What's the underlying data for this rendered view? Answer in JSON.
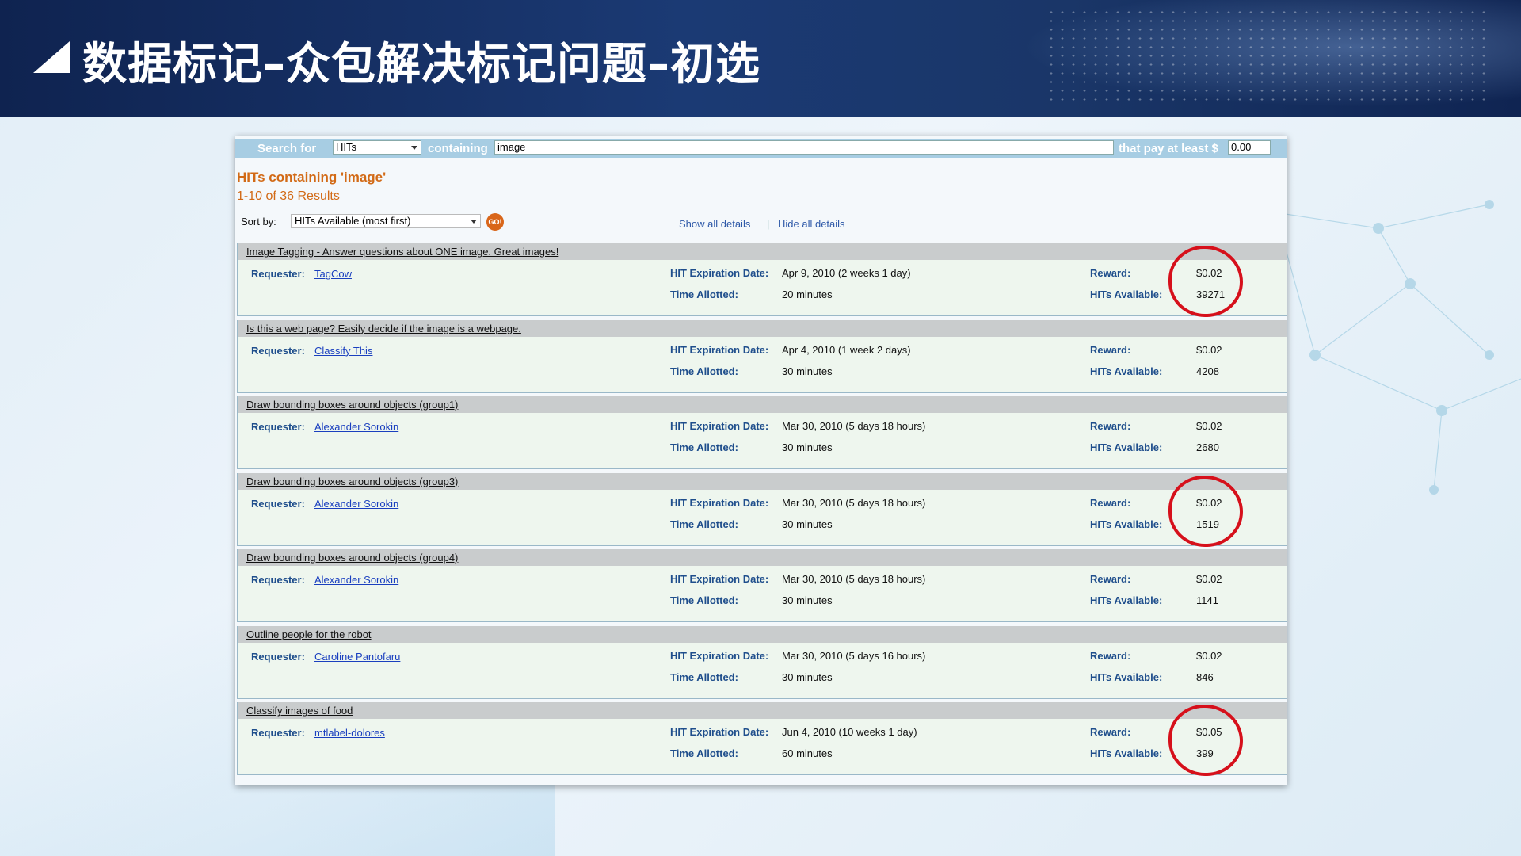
{
  "slide": {
    "title": "数据标记–众包解决标记问题–初选"
  },
  "search": {
    "search_for_label": "Search for",
    "type_value": "HITs",
    "containing_label": "containing",
    "query_value": "image",
    "pay_label": "that pay at least $",
    "pay_value": "0.00"
  },
  "results": {
    "title": "HITs containing 'image'",
    "count": "1-10 of 36 Results",
    "sort_label": "Sort by:",
    "sort_value": "HITs Available (most first)",
    "go_label": "GO!",
    "show_all": "Show all details",
    "separator": "|",
    "hide_all": "Hide all details"
  },
  "labels": {
    "requester": "Requester:",
    "expiration": "HIT Expiration Date:",
    "time_allotted": "Time Allotted:",
    "reward": "Reward:",
    "hits_available": "HITs Available:"
  },
  "hits": [
    {
      "title": "Image Tagging - Answer questions about ONE image. Great images!",
      "requester": "TagCow",
      "expiration": "Apr 9, 2010  (2 weeks 1 day)",
      "time": "20 minutes",
      "reward": "$0.02",
      "available": "39271",
      "circled": true
    },
    {
      "title": "Is this a web page? Easily decide if the image is a webpage.",
      "requester": "Classify This",
      "expiration": "Apr 4, 2010  (1 week 2 days)",
      "time": "30 minutes",
      "reward": "$0.02",
      "available": "4208",
      "circled": false
    },
    {
      "title": "Draw bounding boxes around objects (group1)",
      "requester": "Alexander Sorokin",
      "expiration": "Mar 30, 2010  (5 days 18 hours)",
      "time": "30 minutes",
      "reward": "$0.02",
      "available": "2680",
      "circled": false
    },
    {
      "title": "Draw bounding boxes around objects (group3)",
      "requester": "Alexander Sorokin",
      "expiration": "Mar 30, 2010  (5 days 18 hours)",
      "time": "30 minutes",
      "reward": "$0.02",
      "available": "1519",
      "circled": true
    },
    {
      "title": "Draw bounding boxes around objects (group4)",
      "requester": "Alexander Sorokin",
      "expiration": "Mar 30, 2010  (5 days 18 hours)",
      "time": "30 minutes",
      "reward": "$0.02",
      "available": "1141",
      "circled": false
    },
    {
      "title": "Outline people for the robot",
      "requester": "Caroline Pantofaru",
      "expiration": "Mar 30, 2010  (5 days 16 hours)",
      "time": "30 minutes",
      "reward": "$0.02",
      "available": "846",
      "circled": false
    },
    {
      "title": "Classify images of food",
      "requester": "mtlabel-dolores",
      "expiration": "Jun 4, 2010  (10 weeks 1 day)",
      "time": "60 minutes",
      "reward": "$0.05",
      "available": "399",
      "circled": true
    }
  ],
  "colors": {
    "annotation_circle": "#d6101b",
    "result_orange": "#d26a16",
    "label_blue": "#1f4e8c"
  }
}
